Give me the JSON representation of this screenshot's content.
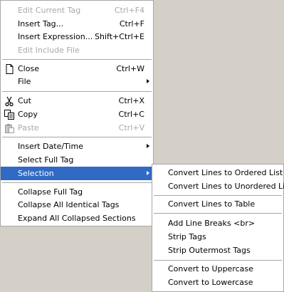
{
  "main_menu": {
    "items": [
      {
        "label": "Edit Current Tag",
        "shortcut": "Ctrl+F4"
      },
      {
        "label": "Insert Tag...",
        "shortcut": "Ctrl+F"
      },
      {
        "label": "Insert Expression...",
        "shortcut": "Shift+Ctrl+E"
      },
      {
        "label": "Edit Include File"
      },
      {
        "label": "Close",
        "shortcut": "Ctrl+W",
        "icon": "close-document-icon"
      },
      {
        "label": "File"
      },
      {
        "label": "Cut",
        "shortcut": "Ctrl+X",
        "icon": "scissors-icon"
      },
      {
        "label": "Copy",
        "shortcut": "Ctrl+C",
        "icon": "copy-icon"
      },
      {
        "label": "Paste",
        "shortcut": "Ctrl+V",
        "icon": "paste-icon"
      },
      {
        "label": "Insert Date/Time"
      },
      {
        "label": "Select Full Tag"
      },
      {
        "label": "Selection"
      },
      {
        "label": "Collapse Full Tag"
      },
      {
        "label": "Collapse All Identical Tags"
      },
      {
        "label": "Expand All Collapsed Sections"
      }
    ]
  },
  "sub_menu": {
    "items": [
      {
        "label": "Convert Lines to Ordered List"
      },
      {
        "label": "Convert Lines to Unordered List"
      },
      {
        "label": "Convert Lines to Table"
      },
      {
        "label": "Add Line Breaks <br>"
      },
      {
        "label": "Strip Tags"
      },
      {
        "label": "Strip Outermost Tags"
      },
      {
        "label": "Convert to Uppercase"
      },
      {
        "label": "Convert to Lowercase"
      }
    ]
  },
  "colors": {
    "highlight": "#316ac5",
    "disabled_text": "#a8a8a8",
    "background": "#d4d0c8"
  }
}
